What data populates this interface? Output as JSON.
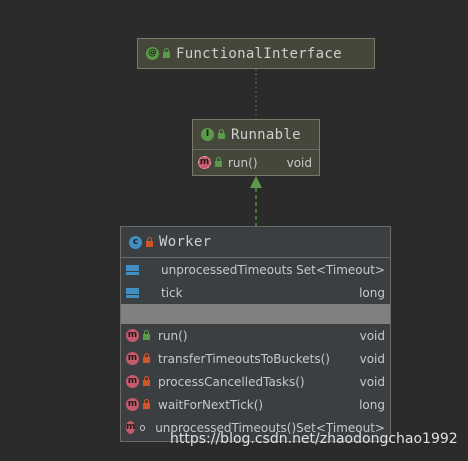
{
  "annotation_box": {
    "icon": "at-sign-annotation-icon",
    "name": "FunctionalInterface"
  },
  "interface_box": {
    "icon": "interface-icon",
    "name": "Runnable",
    "methods": [
      {
        "name": "run()",
        "type": "void",
        "icon": "method-abstract-icon"
      }
    ]
  },
  "class_box": {
    "icon": "class-icon",
    "name": "Worker",
    "fields": [
      {
        "name": "unprocessedTimeouts",
        "type": "Set<Timeout>",
        "icon": "final-field-icon"
      },
      {
        "name": "tick",
        "type": "long",
        "icon": "final-field-icon"
      }
    ],
    "methods": [
      {
        "name": "run()",
        "type": "void",
        "visibility": "public"
      },
      {
        "name": "transferTimeoutsToBuckets()",
        "type": "void",
        "visibility": "private"
      },
      {
        "name": "processCancelledTasks()",
        "type": "void",
        "visibility": "private"
      },
      {
        "name": "waitForNextTick()",
        "type": "long",
        "visibility": "private"
      },
      {
        "name": "unprocessedTimeouts()",
        "type": "Set<Timeout>",
        "visibility": "package"
      }
    ]
  },
  "colors": {
    "background": "#2b2b2b",
    "box": "#3c3f41",
    "implements_arrow": "#5b9a4b",
    "annotation_link": "#6a8a5a"
  },
  "watermark": "https://blog.csdn.net/zhaodongchao1992"
}
